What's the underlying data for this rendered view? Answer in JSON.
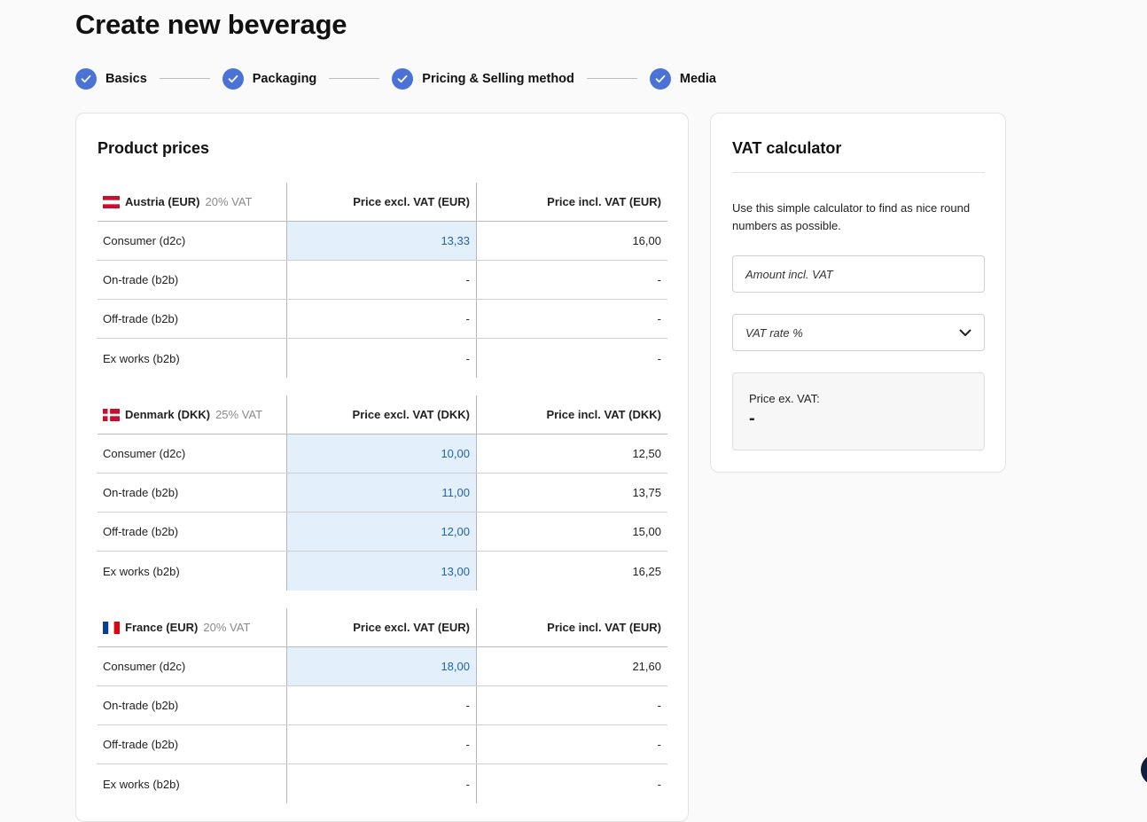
{
  "page": {
    "title": "Create new beverage"
  },
  "stepper": {
    "steps": [
      {
        "label": "Basics",
        "status": "complete"
      },
      {
        "label": "Packaging",
        "status": "complete"
      },
      {
        "label": "Pricing & Selling method",
        "status": "complete"
      },
      {
        "label": "Media",
        "status": "complete"
      }
    ],
    "accent_color": "#4b73d6"
  },
  "prices": {
    "title": "Product prices",
    "countries": [
      {
        "name": "Austria (EUR)",
        "vat": "20% VAT",
        "col_excl": "Price excl. VAT (EUR)",
        "col_incl": "Price incl. VAT (EUR)",
        "rows": [
          {
            "label": "Consumer (d2c)",
            "excl": "13,33",
            "incl": "16,00"
          },
          {
            "label": "On-trade (b2b)",
            "excl": "-",
            "incl": "-"
          },
          {
            "label": "Off-trade (b2b)",
            "excl": "-",
            "incl": "-"
          },
          {
            "label": "Ex works (b2b)",
            "excl": "-",
            "incl": "-"
          }
        ]
      },
      {
        "name": "Denmark (DKK)",
        "vat": "25% VAT",
        "col_excl": "Price excl. VAT (DKK)",
        "col_incl": "Price incl. VAT (DKK)",
        "rows": [
          {
            "label": "Consumer (d2c)",
            "excl": "10,00",
            "incl": "12,50"
          },
          {
            "label": "On-trade (b2b)",
            "excl": "11,00",
            "incl": "13,75"
          },
          {
            "label": "Off-trade (b2b)",
            "excl": "12,00",
            "incl": "15,00"
          },
          {
            "label": "Ex works (b2b)",
            "excl": "13,00",
            "incl": "16,25"
          }
        ]
      },
      {
        "name": "France (EUR)",
        "vat": "20% VAT",
        "col_excl": "Price excl. VAT (EUR)",
        "col_incl": "Price incl. VAT (EUR)",
        "rows": [
          {
            "label": "Consumer (d2c)",
            "excl": "18,00",
            "incl": "21,60"
          },
          {
            "label": "On-trade (b2b)",
            "excl": "-",
            "incl": "-"
          },
          {
            "label": "Off-trade (b2b)",
            "excl": "-",
            "incl": "-"
          },
          {
            "label": "Ex works (b2b)",
            "excl": "-",
            "incl": "-"
          }
        ]
      }
    ]
  },
  "vat_calculator": {
    "title": "VAT calculator",
    "description": "Use this simple calculator to find as nice round numbers as possible.",
    "amount_placeholder": "Amount incl. VAT",
    "rate_placeholder": "VAT rate %",
    "result_label": "Price ex. VAT:",
    "result_value": "-"
  }
}
